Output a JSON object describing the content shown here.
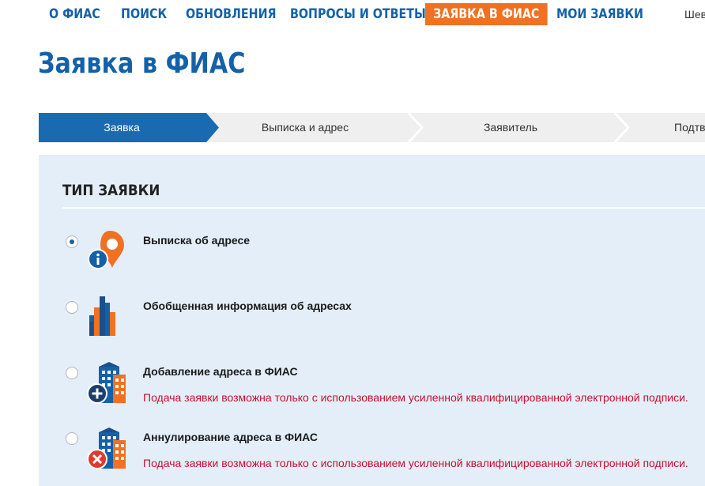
{
  "nav": {
    "items": [
      {
        "label": "О ФИАС"
      },
      {
        "label": "ПОИСК"
      },
      {
        "label": "ОБНОВЛЕНИЯ"
      },
      {
        "label": "ВОПРОСЫ И ОТВЕТЫ"
      },
      {
        "label": "ЗАЯВКА В ФИАС",
        "active": true
      },
      {
        "label": "МОИ ЗАЯВКИ"
      }
    ],
    "user_name": "Шев"
  },
  "page": {
    "title": "Заявка в ФИАС"
  },
  "steps": [
    {
      "label": "Заявка",
      "active": true
    },
    {
      "label": "Выписка и адрес"
    },
    {
      "label": "Заявитель"
    },
    {
      "label": "Подтв"
    }
  ],
  "section": {
    "title": "ТИП ЗАЯВКИ",
    "options": [
      {
        "label": "Выписка об адресе",
        "selected": true,
        "icon": "address-info-icon",
        "note": ""
      },
      {
        "label": "Обобщенная информация об адресах",
        "selected": false,
        "icon": "bar-chart-icon",
        "note": ""
      },
      {
        "label": "Добавление адреса в ФИАС",
        "selected": false,
        "icon": "add-building-icon",
        "note": "Подача заявки возможна только с использованием усиленной квалифицированной электронной подписи."
      },
      {
        "label": "Аннулирование адреса в ФИАС",
        "selected": false,
        "icon": "cancel-building-icon",
        "note": "Подача заявки возможна только с использованием усиленной квалифицированной электронной подписи."
      }
    ]
  },
  "colors": {
    "brand_blue": "#1561a8",
    "accent_orange": "#f07122",
    "panel_bg": "#e4eef9",
    "warning_red": "#c8102e"
  }
}
